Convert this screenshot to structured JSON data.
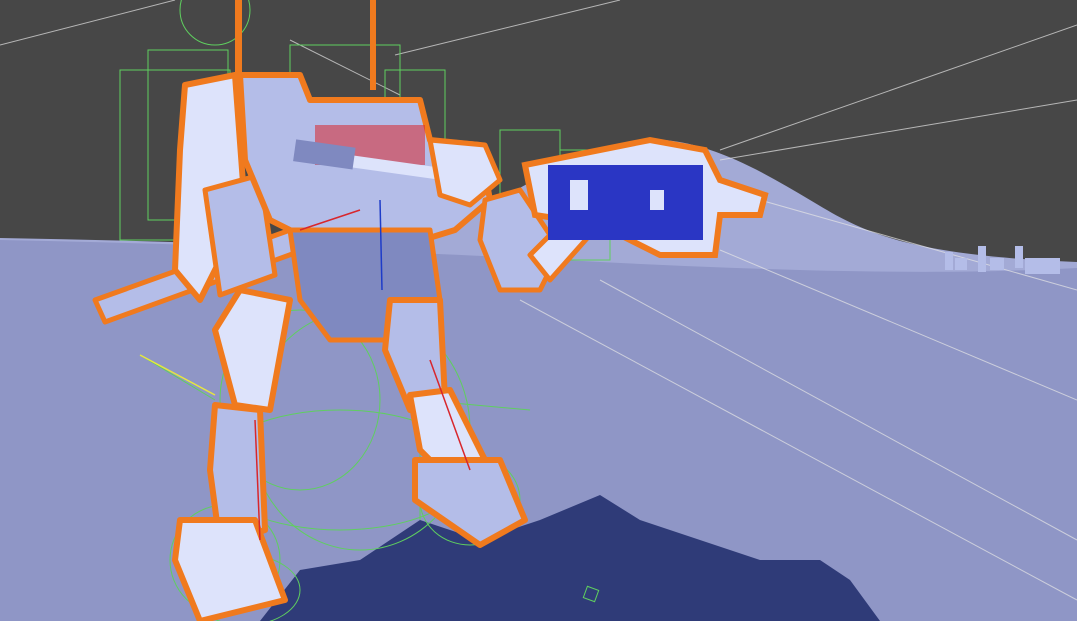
{
  "scene": {
    "view": "scene-viewport",
    "colors": {
      "sky": "#474747",
      "ground": "#8f96c6",
      "ground_far": "#a3aad6",
      "shadow": "#2f3b78",
      "mech_fill": "#b4bde8",
      "mech_light": "#dde3fb",
      "mech_shade": "#7f89c0",
      "selection_outline": "#f07a1e",
      "collider_wire": "#5fcf5f",
      "camera_line": "#e6e6e6",
      "weapon_panel": "#2a36c4",
      "axis_red": "#d8262c",
      "axis_blue": "#1e3cc8",
      "axis_yellow": "#e6e640"
    },
    "objects": {
      "mech": "mech-robot",
      "weapon": "shoulder-cannon",
      "gun": "rifle-arm",
      "props": "distant-buildings"
    }
  }
}
